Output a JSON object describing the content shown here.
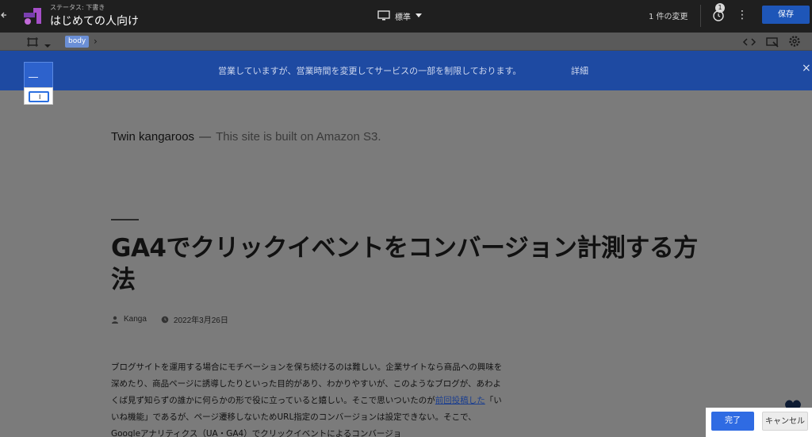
{
  "topbar": {
    "status_label": "ステータス: 下書き",
    "title": "はじめての人向け",
    "device": "標準",
    "changes": "1 件の変更",
    "badge_count": "1",
    "more": "⋮",
    "save_label": "保存"
  },
  "toolbar": {
    "body_chip": "body"
  },
  "banner": {
    "text": "営業していますが、営業時間を変更してサービスの一部を制限しております。",
    "link": "詳細",
    "close": "×"
  },
  "site": {
    "name": "Twin kangaroos",
    "dash": "—",
    "tagline": "This site is built on Amazon S3."
  },
  "post": {
    "title": "GA4でクリックイベントをコンバージョン計測する方法",
    "author": "Kanga",
    "date": "2022年3月26日",
    "para1": "ブログサイトを運用する場合にモチベーションを保ち続けるのは難しい。企業サイトなら商品への興味を深めたり、商品ページに誘導したりといった目的があり、わかりやすいが、このようなブログが、あわよくば見ず知らずの誰かに何らかの形で役に立っていると嬉しい。そこで思いついたのが",
    "link_text": "前回投稿した",
    "para2": "「いいね機能」であるが、ページ遷移しないためURL指定のコンバージョンは設定できない。そこで、Googleアナリティクス（UA・GA4）でクリックイベントによるコンバージョ"
  },
  "actions": {
    "done_label": "完了",
    "cancel_label": "キャンセル"
  },
  "colors": {
    "topbar_bg": "#1f1f1f",
    "banner_bg": "#1e4aa2",
    "save_bg": "#1e56b8",
    "done_bg": "#2f6be3"
  }
}
